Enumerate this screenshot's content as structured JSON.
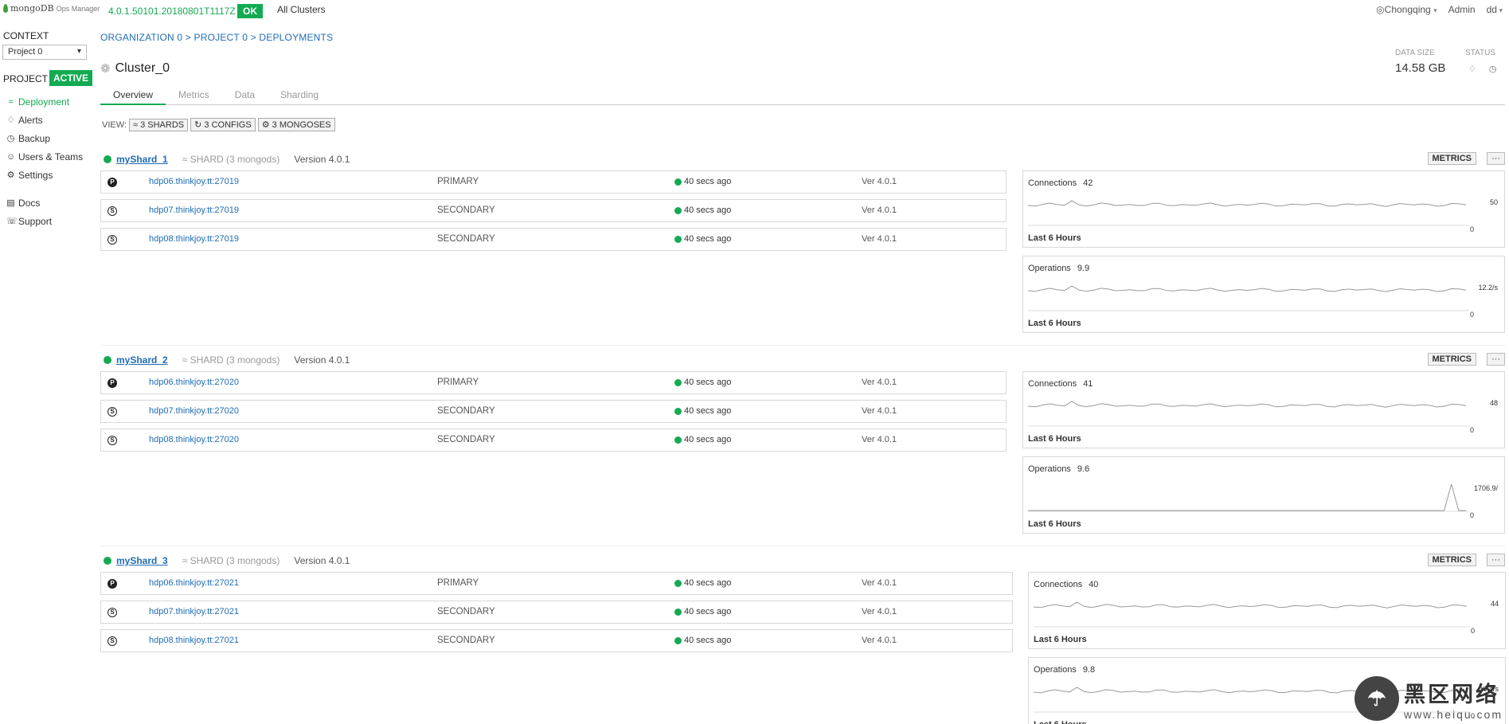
{
  "topbar": {
    "logo_mongo": "mongoDB",
    "logo_ops": "Ops Manager",
    "version": "4.0.1.50101.20180801T1117Z",
    "ok": "OK",
    "all_clusters": "All Clusters",
    "location": "Chongqing",
    "admin": "Admin",
    "user": "dd"
  },
  "sidebar": {
    "context_label": "CONTEXT",
    "project_select": "Project 0",
    "project_label": "PROJECT",
    "active": "ACTIVE",
    "items": [
      {
        "label": "Deployment",
        "icon": "deployment-icon",
        "selected": true
      },
      {
        "label": "Alerts",
        "icon": "bell-icon",
        "selected": false
      },
      {
        "label": "Backup",
        "icon": "clock-icon",
        "selected": false
      },
      {
        "label": "Users & Teams",
        "icon": "user-icon",
        "selected": false
      },
      {
        "label": "Settings",
        "icon": "gear-icon",
        "selected": false
      }
    ],
    "secondary": [
      {
        "label": "Docs",
        "icon": "book-icon"
      },
      {
        "label": "Support",
        "icon": "headset-icon"
      }
    ]
  },
  "breadcrumb": "ORGANIZATION 0 > PROJECT 0 > DEPLOYMENTS",
  "cluster": {
    "name": "Cluster_0",
    "data_size_label": "DATA SIZE",
    "data_size": "14.58 GB",
    "status_label": "STATUS"
  },
  "tabs": [
    "Overview",
    "Metrics",
    "Data",
    "Sharding"
  ],
  "view": {
    "label": "VIEW:",
    "shards": "3 SHARDS",
    "configs": "3 CONFIGS",
    "mongoses": "3 MONGOSES"
  },
  "metrics_button": "METRICS",
  "more_button": "···",
  "metric_footer": "Last 6 Hours",
  "shards": [
    {
      "name": "myShard_1",
      "type": "SHARD (3 mongods)",
      "version": "Version 4.0.1",
      "processes": [
        {
          "host": "hdp06.thinkjoy.tt:27019",
          "role": "PRIMARY",
          "badge": "P",
          "ping": "40 secs ago",
          "ver": "Ver 4.0.1"
        },
        {
          "host": "hdp07.thinkjoy.tt:27019",
          "role": "SECONDARY",
          "badge": "S",
          "ping": "40 secs ago",
          "ver": "Ver 4.0.1"
        },
        {
          "host": "hdp08.thinkjoy.tt:27019",
          "role": "SECONDARY",
          "badge": "S",
          "ping": "40 secs ago",
          "ver": "Ver 4.0.1"
        }
      ],
      "connections": {
        "label": "Connections",
        "value": "42",
        "max": "50",
        "min": "0"
      },
      "operations": {
        "label": "Operations",
        "value": "9.9",
        "max": "12.2/s",
        "min": "0"
      }
    },
    {
      "name": "myShard_2",
      "type": "SHARD (3 mongods)",
      "version": "Version 4.0.1",
      "processes": [
        {
          "host": "hdp06.thinkjoy.tt:27020",
          "role": "PRIMARY",
          "badge": "P",
          "ping": "40 secs ago",
          "ver": "Ver 4.0.1"
        },
        {
          "host": "hdp07.thinkjoy.tt:27020",
          "role": "SECONDARY",
          "badge": "S",
          "ping": "40 secs ago",
          "ver": "Ver 4.0.1"
        },
        {
          "host": "hdp08.thinkjoy.tt:27020",
          "role": "SECONDARY",
          "badge": "S",
          "ping": "40 secs ago",
          "ver": "Ver 4.0.1"
        }
      ],
      "connections": {
        "label": "Connections",
        "value": "41",
        "max": "48",
        "min": "0"
      },
      "operations": {
        "label": "Operations",
        "value": "9.6",
        "max": "1706.9/",
        "min": "0"
      }
    },
    {
      "name": "myShard_3",
      "type": "SHARD (3 mongods)",
      "version": "Version 4.0.1",
      "processes": [
        {
          "host": "hdp06.thinkjoy.tt:27021",
          "role": "PRIMARY",
          "badge": "P",
          "ping": "40 secs ago",
          "ver": "Ver 4.0.1"
        },
        {
          "host": "hdp07.thinkjoy.tt:27021",
          "role": "SECONDARY",
          "badge": "S",
          "ping": "40 secs ago",
          "ver": "Ver 4.0.1"
        },
        {
          "host": "hdp08.thinkjoy.tt:27021",
          "role": "SECONDARY",
          "badge": "S",
          "ping": "40 secs ago",
          "ver": "Ver 4.0.1"
        }
      ],
      "connections": {
        "label": "Connections",
        "value": "40",
        "max": "44",
        "min": "0"
      },
      "operations": {
        "label": "Operations",
        "value": "9.8",
        "max": "10.4/s",
        "min": "0"
      }
    }
  ],
  "watermark": {
    "cn": "黑区网络",
    "url": "www.heiqu.com"
  },
  "colors": {
    "accent": "#13aa52",
    "link": "#1f6db5"
  }
}
